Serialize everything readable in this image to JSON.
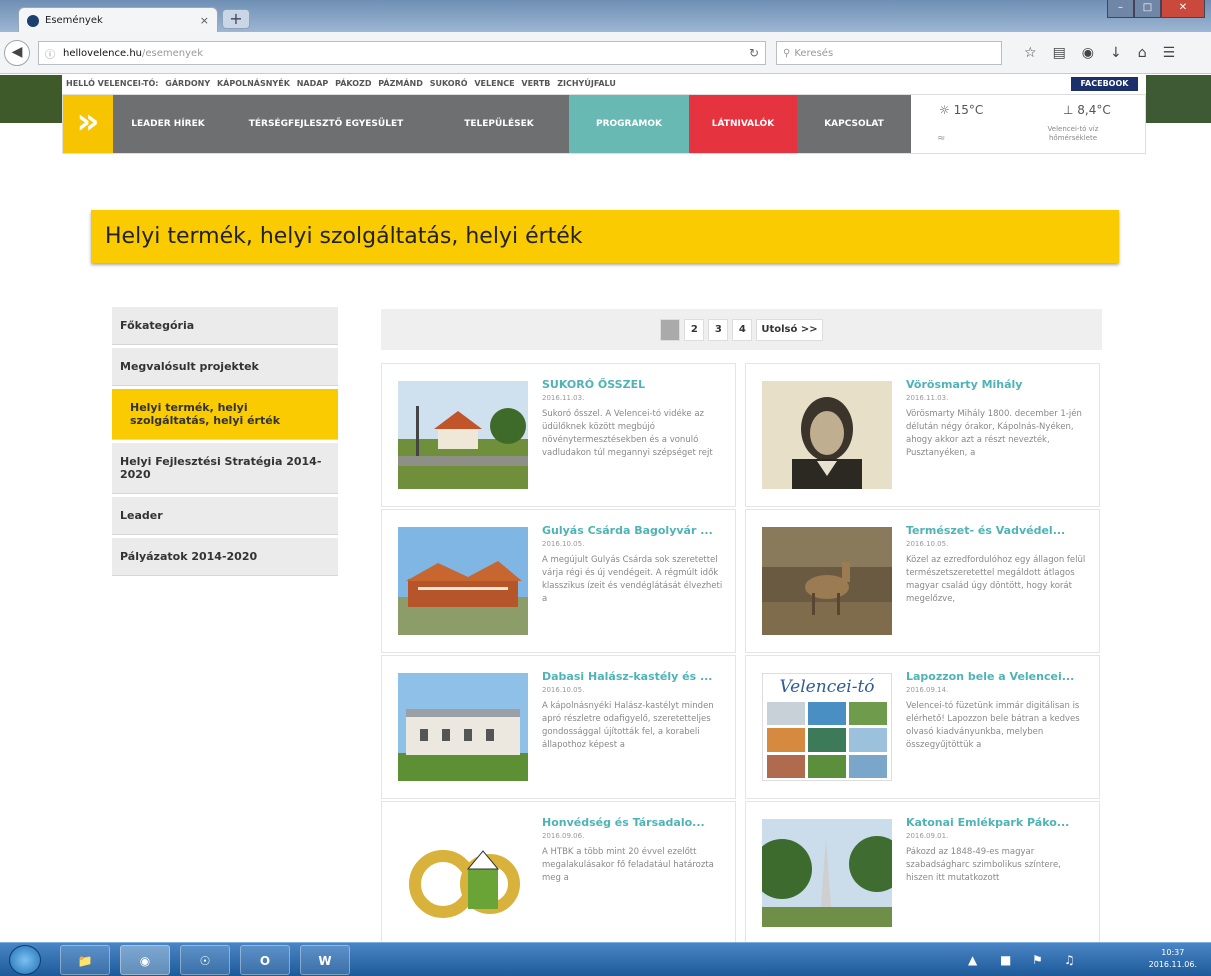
{
  "browser": {
    "tab_title": "Események",
    "tab_close": "×",
    "new_tab": "+",
    "url_host": "hellovelence.hu",
    "url_path": "/esemenyek",
    "search_placeholder": "Keresés",
    "win_min": "–",
    "win_max": "□",
    "win_close": "✕"
  },
  "site": {
    "top_links": [
      "HELLÓ VELENCEI-TÓ:",
      "GÁRDONY",
      "KÁPOLNÁSNYÉK",
      "NADAP",
      "PÁKOZD",
      "PÁZMÁND",
      "SUKORÓ",
      "VELENCE",
      "VERTB",
      "ZICHYÚJFALU"
    ],
    "facebook": "FACEBOOK",
    "nav": [
      {
        "label": "LEADER HÍREK",
        "color": "#6d6f71"
      },
      {
        "label": "TÉRSÉGFEJLESZTŐ EGYESÜLET",
        "color": "#6d6f71"
      },
      {
        "label": "TELEPÜLÉSEK",
        "color": "#6d6f71"
      },
      {
        "label": "PROGRAMOK",
        "color": "#68b8b3"
      },
      {
        "label": "LÁTNIVALÓK",
        "color": "#e53340"
      },
      {
        "label": "KAPCSOLAT",
        "color": "#6d6f71"
      }
    ],
    "weather": {
      "temp_air": "15°C",
      "temp_water": "8,4°C",
      "note": "Velencei-tó víz hőmérséklete"
    },
    "heading": "Helyi termék, helyi szolgáltatás, helyi érték",
    "sidebar": [
      {
        "label": "Főkategória",
        "active": false
      },
      {
        "label": "Megvalósult projektek",
        "active": false
      },
      {
        "label": "Helyi termék, helyi szolgáltatás, helyi érték",
        "active": true
      },
      {
        "label": "Helyi Fejlesztési Stratégia 2014-2020",
        "active": false
      },
      {
        "label": "Leader",
        "active": false
      },
      {
        "label": "Pályázatok 2014-2020",
        "active": false
      }
    ],
    "pagination": [
      "1",
      "2",
      "3",
      "4",
      "Utolsó >>"
    ],
    "cards": [
      {
        "title": "SUKORÓ ŐSSZEL",
        "date": "2016.11.03.",
        "text": "Sukoró ősszel. A Velencei-tó vidéke az üdülőknek között megbújó növénytermesztésekben és a vonuló vadludakon túl megannyi szépséget rejt"
      },
      {
        "title": "Vörösmarty Mihály",
        "date": "2016.11.03.",
        "text": "Vörösmarty Mihály 1800. december 1-jén délután négy órakor, Kápolnás-Nyéken, ahogy akkor azt a részt nevezték, Pusztanyéken, a"
      },
      {
        "title": "Gulyás Csárda Bagolyvár ...",
        "date": "2016.10.05.",
        "text": "A megújult Gulyás Csárda sok szeretettel várja régi és új vendégeit. A régmúlt idők klasszikus ízeit és vendéglátását élvezheti a"
      },
      {
        "title": "Természet- és Vadvédel...",
        "date": "2016.10.05.",
        "text": "Közel az ezredfordulóhoz egy állagon felül természetszeretettel megáldott átlagos magyar család úgy döntött, hogy korát megelőzve,"
      },
      {
        "title": "Dabasi Halász-kastély és ...",
        "date": "2016.10.05.",
        "text": "A kápolnásnyéki Halász-kastélyt minden apró részletre odafigyelő, szeretetteljes gondossággal újították fel, a korabeli állapothoz képest a"
      },
      {
        "title": "Lapozzon bele a Velencei...",
        "date": "2016.09.14.",
        "text": "Velencei-tó füzetünk immár digitálisan is elérhető! Lapozzon bele bátran a kedves olvasó kiadványunkba, melyben összegyűjtöttük a"
      },
      {
        "title": "Honvédség és Társadalo...",
        "date": "2016.09.06.",
        "text": "A HTBK a több mint 20 évvel ezelőtt megalakulásakor fő feladatául határozta meg a"
      },
      {
        "title": "Katonai Emlékpark Páko...",
        "date": "2016.09.01.",
        "text": "Pákozd az 1848-49-es magyar szabadságharc szimbolikus színtere, hiszen itt mutatkozott"
      }
    ],
    "brochure_text": "Velencei-tó"
  },
  "taskbar": {
    "time": "10:37",
    "date": "2016.11.06."
  }
}
